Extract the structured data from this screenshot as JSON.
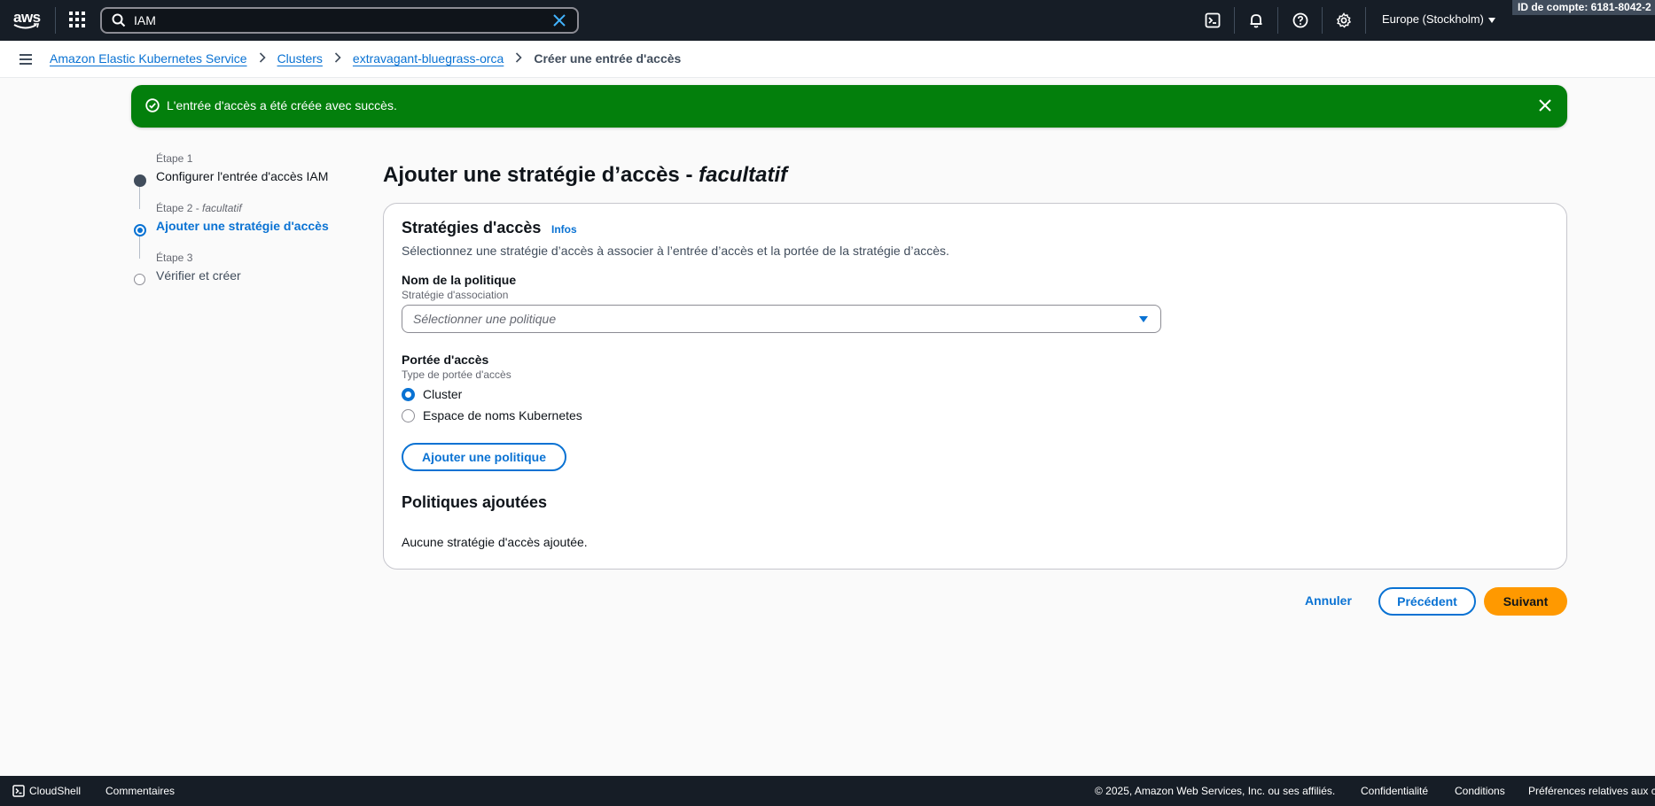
{
  "topnav": {
    "logo_text": "aws",
    "search_value": "IAM",
    "region": "Europe (Stockholm)",
    "account_id": "ID de compte: 6181-8042-2"
  },
  "breadcrumb": {
    "items": [
      "Amazon Elastic Kubernetes Service",
      "Clusters",
      "extravagant-bluegrass-orca"
    ],
    "current": "Créer une entrée d'accès"
  },
  "flash": {
    "message": "L'entrée d'accès a été créée avec succès.",
    "color": "#037f0c"
  },
  "steps": [
    {
      "label": "Étape 1",
      "title": "Configurer l'entrée d'accès IAM",
      "state": "done"
    },
    {
      "label": "Étape 2",
      "label_suffix": "facultatif",
      "title": "Ajouter une stratégie d'accès",
      "state": "active"
    },
    {
      "label": "Étape 3",
      "title": "Vérifier et créer",
      "state": "todo"
    }
  ],
  "page": {
    "title": "Ajouter une stratégie d’accès -",
    "title_optional": "facultatif"
  },
  "panel": {
    "heading": "Stratégies d'accès",
    "info_link": "Infos",
    "description": "Sélectionnez une stratégie d’accès à associer à l’entrée d’accès et la portée de la stratégie d’accès.",
    "policy_label": "Nom de la politique",
    "policy_sub": "Stratégie d'association",
    "policy_placeholder": "Sélectionner une politique",
    "scope_label": "Portée d'accès",
    "scope_sub": "Type de portée d'accès",
    "scope_options": [
      "Cluster",
      "Espace de noms Kubernetes"
    ],
    "scope_selected": "Cluster",
    "add_policy_button": "Ajouter une politique",
    "added_heading": "Politiques ajoutées",
    "empty_text": "Aucune stratégie d'accès ajoutée."
  },
  "actions": {
    "cancel": "Annuler",
    "previous": "Précédent",
    "next": "Suivant",
    "primary_color": "#ff9900",
    "link_color": "#0972d3"
  },
  "footer": {
    "cloudshell": "CloudShell",
    "feedback": "Commentaires",
    "copyright": "© 2025, Amazon Web Services, Inc. ou ses affiliés.",
    "privacy": "Confidentialité",
    "terms": "Conditions",
    "cookies": "Préférences relatives aux c"
  }
}
